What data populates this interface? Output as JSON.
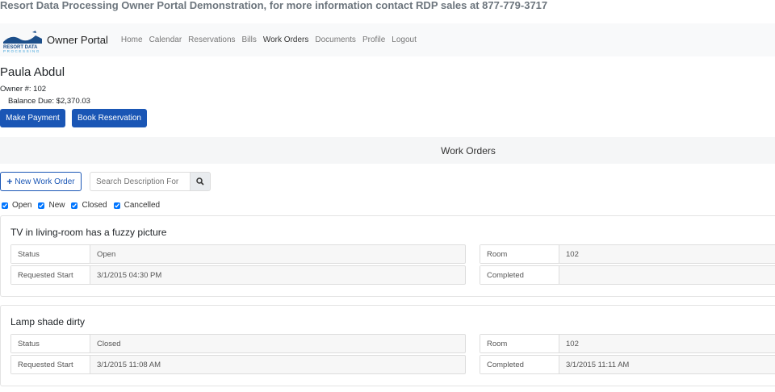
{
  "banner": "Resort Data Processing Owner Portal Demonstration, for more information contact RDP sales at 877-779-3717",
  "nav": {
    "logo_text": "RESORT DATA PROCESSING",
    "brand": "Owner Portal",
    "items": [
      "Home",
      "Calendar",
      "Reservations",
      "Bills",
      "Work Orders",
      "Documents",
      "Profile",
      "Logout"
    ],
    "active": "Work Orders"
  },
  "owner": {
    "name": "Paula Abdul",
    "number": "Owner #: 102",
    "balance": "Balance Due: $2,370.03"
  },
  "buttons": {
    "payment": "Make Payment",
    "reservation": "Book Reservation"
  },
  "section_title": "Work Orders",
  "toolbar": {
    "new_label": "New Work Order",
    "search_placeholder": "Search Description For"
  },
  "filters": [
    "Open",
    "New",
    "Closed",
    "Cancelled"
  ],
  "work_orders": [
    {
      "title": "TV in living-room has a fuzzy picture",
      "status_label": "Status",
      "status": "Open",
      "start_label": "Requested Start",
      "start": "3/1/2015 04:30 PM",
      "room_label": "Room",
      "room": "102",
      "completed_label": "Completed",
      "completed": ""
    },
    {
      "title": "Lamp shade dirty",
      "status_label": "Status",
      "status": "Closed",
      "start_label": "Requested Start",
      "start": "3/1/2015 11:08 AM",
      "room_label": "Room",
      "room": "102",
      "completed_label": "Completed",
      "completed": "3/1/2015 11:11 AM"
    }
  ],
  "colors": {
    "primary": "#1a56b5"
  }
}
